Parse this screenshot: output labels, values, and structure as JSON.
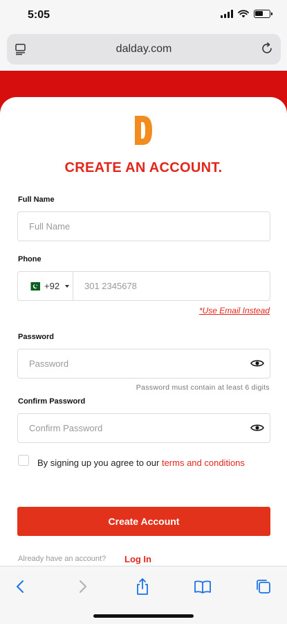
{
  "status": {
    "time": "5:05"
  },
  "browser": {
    "url": "dalday.com"
  },
  "colors": {
    "accent": "#e2261c",
    "band": "#d70e0e",
    "button": "#e2321b"
  },
  "page": {
    "title": "CREATE AN ACCOUNT.",
    "full_name": {
      "label": "Full Name",
      "placeholder": "Full Name"
    },
    "phone": {
      "label": "Phone",
      "country_code": "+92",
      "placeholder": "301 2345678",
      "switch_link": "*Use Email Instead"
    },
    "password": {
      "label": "Password",
      "placeholder": "Password",
      "hint": "Password must contain at least 6 digits"
    },
    "confirm_password": {
      "label": "Confirm Password",
      "placeholder": "Confirm Password"
    },
    "terms": {
      "prefix": "By signing up you agree to our ",
      "link": "terms and conditions"
    },
    "create_button": "Create Account",
    "login_prompt": "Already have an account?",
    "login_link": "Log In"
  },
  "toolbar_icons": [
    "back-icon",
    "forward-icon",
    "share-icon",
    "bookmarks-icon",
    "tabs-icon"
  ]
}
